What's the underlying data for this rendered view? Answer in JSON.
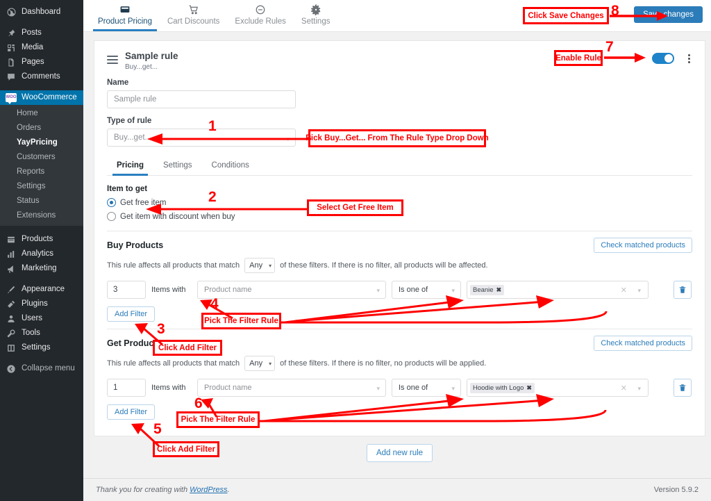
{
  "sidebar": {
    "top_items": [
      {
        "label": "Dashboard",
        "icon": "dashboard-icon"
      },
      {
        "label": "Posts",
        "icon": "pin-icon"
      },
      {
        "label": "Media",
        "icon": "media-icon"
      },
      {
        "label": "Pages",
        "icon": "pages-icon"
      },
      {
        "label": "Comments",
        "icon": "comment-icon"
      }
    ],
    "active_item": {
      "label": "WooCommerce",
      "icon": "woocommerce-icon",
      "badge": "WOO"
    },
    "sub_items": [
      {
        "label": "Home",
        "current": false
      },
      {
        "label": "Orders",
        "current": false
      },
      {
        "label": "YayPricing",
        "current": true
      },
      {
        "label": "Customers",
        "current": false
      },
      {
        "label": "Reports",
        "current": false
      },
      {
        "label": "Settings",
        "current": false
      },
      {
        "label": "Status",
        "current": false
      },
      {
        "label": "Extensions",
        "current": false
      }
    ],
    "group2": [
      {
        "label": "Products",
        "icon": "products-icon"
      },
      {
        "label": "Analytics",
        "icon": "analytics-icon"
      },
      {
        "label": "Marketing",
        "icon": "marketing-icon"
      }
    ],
    "group3": [
      {
        "label": "Appearance",
        "icon": "appearance-icon"
      },
      {
        "label": "Plugins",
        "icon": "plugins-icon"
      },
      {
        "label": "Users",
        "icon": "users-icon"
      },
      {
        "label": "Tools",
        "icon": "tools-icon"
      },
      {
        "label": "Settings",
        "icon": "settings-icon"
      }
    ],
    "collapse": {
      "label": "Collapse menu",
      "icon": "collapse-icon"
    }
  },
  "topbar": {
    "tabs": [
      {
        "label": "Product Pricing",
        "icon": "pricing-icon",
        "active": true
      },
      {
        "label": "Cart Discounts",
        "icon": "cart-icon",
        "active": false
      },
      {
        "label": "Exclude Rules",
        "icon": "minus-circle-icon",
        "active": false
      },
      {
        "label": "Settings",
        "icon": "gear-icon",
        "active": false
      }
    ],
    "save_label": "Save changes"
  },
  "rule": {
    "title": "Sample rule",
    "subtitle": "Buy...get...",
    "name_label": "Name",
    "name_value": "Sample rule",
    "type_label": "Type of rule",
    "type_value": "Buy...get...",
    "inner_tabs": [
      {
        "label": "Pricing",
        "active": true
      },
      {
        "label": "Settings",
        "active": false
      },
      {
        "label": "Conditions",
        "active": false
      }
    ],
    "item_to_get_label": "Item to get",
    "options": [
      {
        "label": "Get free item",
        "selected": true
      },
      {
        "label": "Get item with discount when buy",
        "selected": false
      }
    ],
    "buy_products": {
      "title": "Buy Products",
      "desc_before": "This rule affects all products that match",
      "match_value": "Any",
      "desc_after": "of these filters. If there is no filter, all products will be affected.",
      "check_label": "Check matched products",
      "qty": "3",
      "items_with": "Items with",
      "field": "Product name",
      "operator": "Is one of",
      "tags": [
        "Beanie"
      ],
      "add_filter_label": "Add Filter"
    },
    "get_products": {
      "title": "Get Products",
      "desc_before": "This rule affects all products that match",
      "match_value": "Any",
      "desc_after": "of these filters. If there is no filter, no products will be applied.",
      "check_label": "Check matched products",
      "qty": "1",
      "items_with": "Items with",
      "field": "Product name",
      "operator": "Is one of",
      "tags": [
        "Hoodie with Logo"
      ],
      "add_filter_label": "Add Filter"
    }
  },
  "add_new_rule_label": "Add new rule",
  "footer": {
    "thanks_prefix": "Thank you for creating with ",
    "link": "WordPress",
    "thanks_suffix": ".",
    "version": "Version 5.9.2"
  },
  "annotations": {
    "color": "#fe0000",
    "items": [
      {
        "number": "1",
        "text": "Pick Buy...Get... From The Rule Type Drop Down"
      },
      {
        "number": "2",
        "text": "Select Get Free Item"
      },
      {
        "number": "3",
        "text": "Click Add Filter"
      },
      {
        "number": "4",
        "text": "Pick The Filter Rule"
      },
      {
        "number": "5",
        "text": "Click Add Filter"
      },
      {
        "number": "6",
        "text": "Pick The Filter  Rule"
      },
      {
        "number": "7",
        "text": "Enable Rule"
      },
      {
        "number": "8",
        "text": "Click Save Changes"
      }
    ]
  }
}
